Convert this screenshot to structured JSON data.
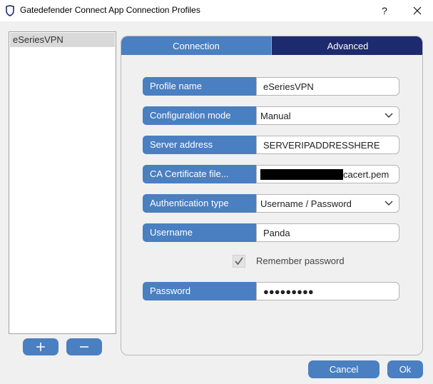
{
  "window": {
    "title": "Gatedefender Connect App Connection Profiles",
    "help_label": "?"
  },
  "profiles": {
    "items": [
      {
        "label": "eSeriesVPN",
        "selected": true
      }
    ],
    "add_icon": "plus-icon",
    "remove_icon": "minus-icon"
  },
  "tabs": [
    {
      "label": "Connection",
      "active": true
    },
    {
      "label": "Advanced",
      "active": false
    }
  ],
  "form": {
    "profile_name": {
      "label": "Profile name",
      "value": "eSeriesVPN"
    },
    "configuration_mode": {
      "label": "Configuration mode",
      "value": "Manual"
    },
    "server_address": {
      "label": "Server address",
      "value": "SERVERIPADDRESSHERE"
    },
    "ca_certificate": {
      "label": "CA Certificate file...",
      "value_suffix": "cacert.pem"
    },
    "authentication_type": {
      "label": "Authentication type",
      "value": "Username / Password"
    },
    "username": {
      "label": "Username",
      "value": "Panda"
    },
    "remember_password": {
      "label": "Remember password",
      "checked": true
    },
    "password": {
      "label": "Password",
      "masked_value": "●●●●●●●●●"
    }
  },
  "buttons": {
    "cancel": "Cancel",
    "ok": "Ok"
  },
  "colors": {
    "accent": "#4a7fc1",
    "tab_inactive": "#1e2a6e",
    "background": "#f0f0f0"
  }
}
